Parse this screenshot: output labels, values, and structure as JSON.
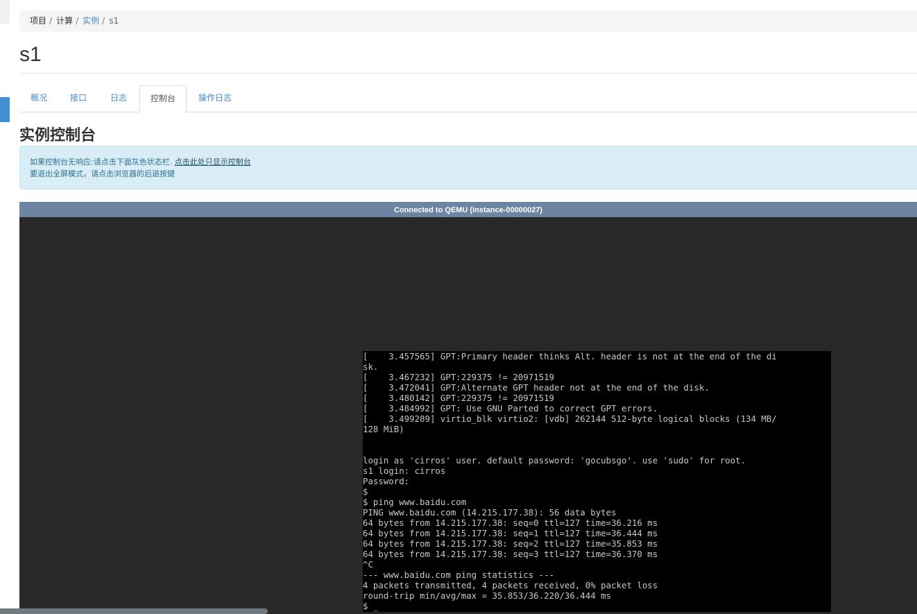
{
  "breadcrumb": {
    "items": [
      "项目",
      "计算",
      "实例",
      "s1"
    ],
    "separator": "/"
  },
  "page": {
    "title": "s1"
  },
  "tabs": [
    {
      "label": "概况",
      "active": false
    },
    {
      "label": "接口",
      "active": false
    },
    {
      "label": "日志",
      "active": false
    },
    {
      "label": "控制台",
      "active": true
    },
    {
      "label": "操作日志",
      "active": false
    }
  ],
  "section": {
    "title": "实例控制台"
  },
  "alert": {
    "line1_text": "如果控制台无响应:请点击下面灰色状态栏.",
    "line1_link": "点击此处只显示控制台",
    "line2_text": "要退出全屏模式，请点击浏览器的后退按键"
  },
  "console": {
    "status": "Connected to QEMU (instance-00000027)",
    "output": "[    3.457565] GPT:Primary header thinks Alt. header is not at the end of the di\nsk.\n[    3.467232] GPT:229375 != 20971519\n[    3.472041] GPT:Alternate GPT header not at the end of the disk.\n[    3.480142] GPT:229375 != 20971519\n[    3.484992] GPT: Use GNU Parted to correct GPT errors.\n[    3.499289] virtio_blk virtio2: [vdb] 262144 512-byte logical blocks (134 MB/\n128 MiB)\n\n\nlogin as 'cirros' user. default password: 'gocubsgo'. use 'sudo' for root.\ns1 login: cirros\nPassword:\n$\n$ ping www.baidu.com\nPING www.baidu.com (14.215.177.38): 56 data bytes\n64 bytes from 14.215.177.38: seq=0 ttl=127 time=36.216 ms\n64 bytes from 14.215.177.38: seq=1 ttl=127 time=36.444 ms\n64 bytes from 14.215.177.38: seq=2 ttl=127 time=35.853 ms\n64 bytes from 14.215.177.38: seq=3 ttl=127 time=36.370 ms\n^C\n--- www.baidu.com ping statistics ---\n4 packets transmitted, 4 packets received, 0% packet loss\nround-trip min/avg/max = 35.853/36.220/36.444 ms\n$ _"
  },
  "colors": {
    "link": "#428bca",
    "alert_bg": "#d9edf7",
    "status_bar": "#6e84a3",
    "console_bg": "#282828",
    "accent": "#3f8fd2"
  }
}
